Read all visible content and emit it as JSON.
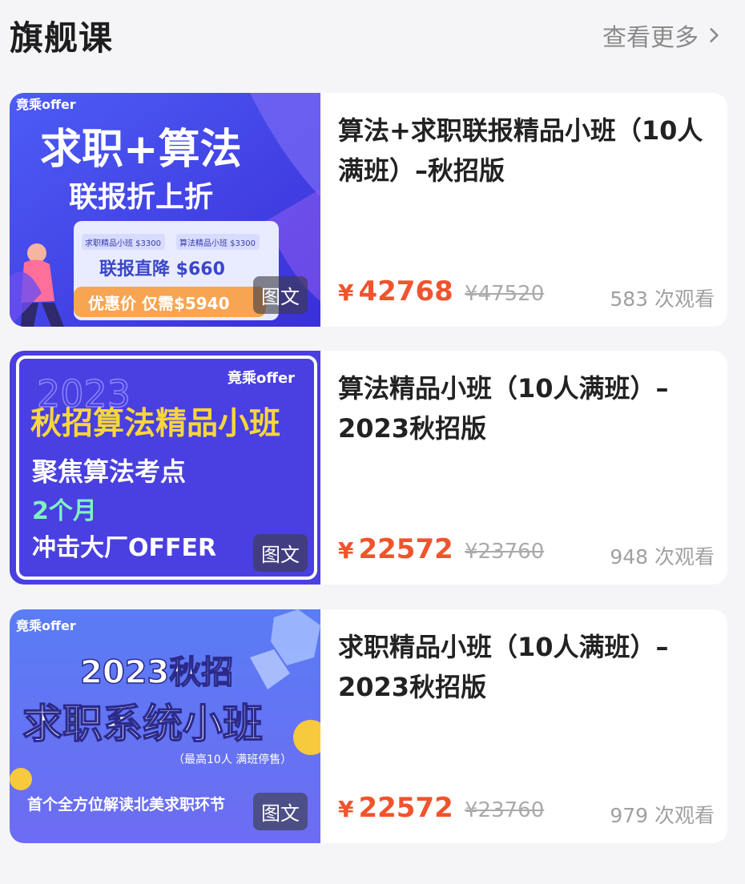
{
  "header": {
    "title": "旗舰课",
    "more_label": "查看更多"
  },
  "courses": [
    {
      "title": "算法+求职联报精品小班（10人满班）–秋招版",
      "price": "42768",
      "currency": "¥",
      "original_price": "¥47520",
      "views": "583 次观看",
      "badge": "图文",
      "thumb": {
        "brand": "竟乘offer",
        "line1": "求职+算法",
        "line2": "联报折上折",
        "item1": "求职精品小班 $3300",
        "item2": "算法精品小班 $3300",
        "discount": "联报直降 $660",
        "offer": "优惠价 仅需$5940"
      }
    },
    {
      "title": "算法精品小班（10人满班）–2023秋招版",
      "price": "22572",
      "currency": "¥",
      "original_price": "¥23760",
      "views": "948 次观看",
      "badge": "图文",
      "thumb": {
        "brand": "竟乘offer",
        "year": "2023",
        "line1": "秋招算法精品小班",
        "line2": "聚焦算法考点",
        "line3": "2个月",
        "line4": "冲击大厂OFFER"
      }
    },
    {
      "title": "求职精品小班（10人满班）–2023秋招版",
      "price": "22572",
      "currency": "¥",
      "original_price": "¥23760",
      "views": "979 次观看",
      "badge": "图文",
      "thumb": {
        "brand": "竟乘offer",
        "line1": "2023秋招",
        "line2": "求职系统小班",
        "line3": "（最高10人 满班停售）",
        "line4": "首个全方位解读北美求职环节"
      }
    }
  ],
  "colors": {
    "price": "#f0542d",
    "muted": "#a0a0a0",
    "background": "#f5f5f7"
  }
}
